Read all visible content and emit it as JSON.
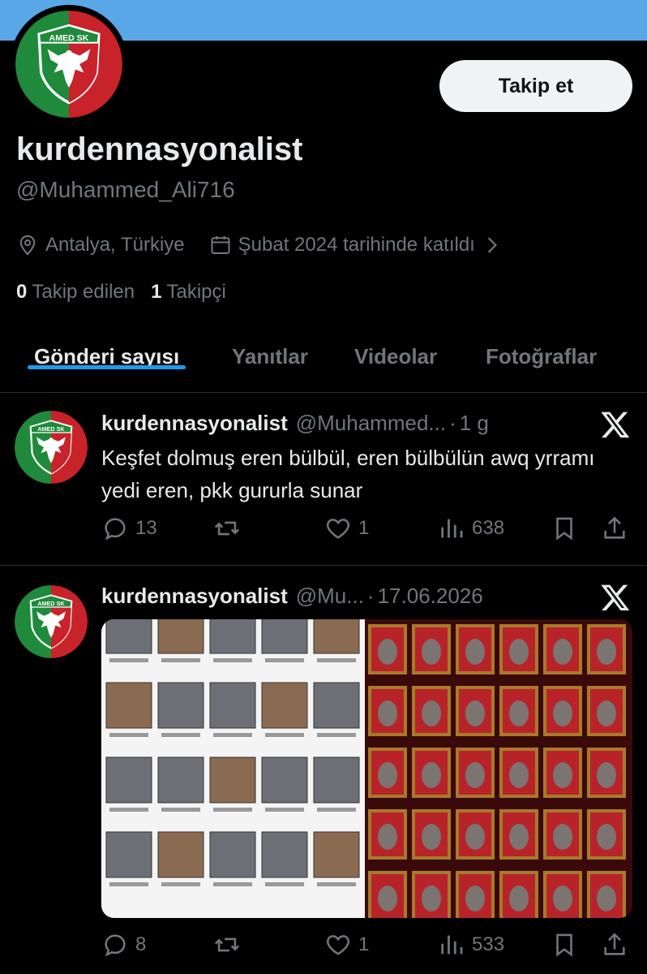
{
  "profile": {
    "display_name": "kurdennasyonalist",
    "handle": "@Muhammed_Ali716",
    "location": "Antalya, Türkiye",
    "joined": "Şubat 2024 tarihinde katıldı",
    "following_count": "0",
    "following_label": "Takip edilen",
    "followers_count": "1",
    "followers_label": "Takipçi",
    "follow_button": "Takip et",
    "logo_text": "AMED SK"
  },
  "tabs": [
    {
      "label": "Gönderi sayısı",
      "active": true
    },
    {
      "label": "Yanıtlar",
      "active": false
    },
    {
      "label": "Videolar",
      "active": false
    },
    {
      "label": "Fotoğraflar",
      "active": false
    }
  ],
  "posts": [
    {
      "name": "kurdennasyonalist",
      "handle": "@Muhammed...",
      "dot": "·",
      "date": "1 g",
      "text": "Keşfet dolmuş eren bülbül, eren bülbülün awq yrramı yedi eren, pkk gururla sunar",
      "replies": "13",
      "reposts": "",
      "likes": "1",
      "views": "638"
    },
    {
      "name": "kurdennasyonalist",
      "handle": "@Mu...",
      "dot": "·",
      "date": "17.06.2026",
      "text": "",
      "replies": "8",
      "reposts": "",
      "likes": "1",
      "views": "533"
    }
  ],
  "colors": {
    "accent": "#1d9bf0",
    "banner": "#5aa7e8",
    "logo_green": "#1f8a3b",
    "logo_red": "#c8222a",
    "muted": "#71767b"
  }
}
